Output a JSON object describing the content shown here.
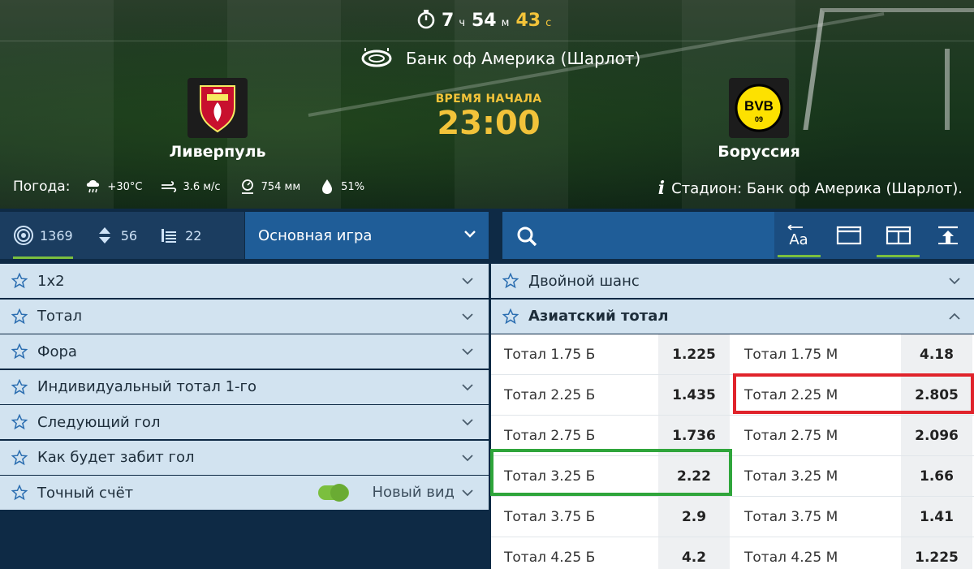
{
  "countdown": {
    "hours": "7",
    "hours_unit": "ч",
    "minutes": "54",
    "minutes_unit": "м",
    "seconds": "43",
    "seconds_unit": "с"
  },
  "venue": "Банк оф Америка (Шарлот)",
  "home_team": "Ливерпуль",
  "away_team": "Боруссия",
  "kickoff": {
    "label": "ВРЕМЯ НАЧАЛА",
    "time": "23:00"
  },
  "weather": {
    "label": "Погода:",
    "temperature": "+30°C",
    "wind": "3.6 м/с",
    "pressure": "754 мм",
    "humidity": "51%"
  },
  "stadium_label": "Стадион: Банк оф Америка (Шарлот).",
  "toolbar": {
    "stats": [
      {
        "icon": "target-icon",
        "value": "1369"
      },
      {
        "icon": "updown-icon",
        "value": "56"
      },
      {
        "icon": "stats-list-icon",
        "value": "22"
      }
    ],
    "game_select": "Основная игра",
    "font_tool": "Aa"
  },
  "left_markets": [
    "1x2",
    "Тотал",
    "Фора",
    "Индивидуальный тотал 1-го",
    "Следующий гол",
    "Как будет забит гол",
    "Точный счёт"
  ],
  "new_view_label": "Новый вид",
  "right_markets": {
    "double_chance": "Двойной шанс",
    "asian_total": "Азиатский тотал"
  },
  "asian_total_rows": [
    {
      "over_label": "Тотал 1.75 Б",
      "over_odds": "1.225",
      "under_label": "Тотал 1.75 М",
      "under_odds": "4.18"
    },
    {
      "over_label": "Тотал 2.25 Б",
      "over_odds": "1.435",
      "under_label": "Тотал 2.25 М",
      "under_odds": "2.805"
    },
    {
      "over_label": "Тотал 2.75 Б",
      "over_odds": "1.736",
      "under_label": "Тотал 2.75 М",
      "under_odds": "2.096"
    },
    {
      "over_label": "Тотал 3.25 Б",
      "over_odds": "2.22",
      "under_label": "Тотал 3.25 М",
      "under_odds": "1.66"
    },
    {
      "over_label": "Тотал 3.75 Б",
      "over_odds": "2.9",
      "under_label": "Тотал 3.75 М",
      "under_odds": "1.41"
    },
    {
      "over_label": "Тотал 4.25 Б",
      "over_odds": "4.2",
      "under_label": "Тотал 4.25 М",
      "under_odds": "1.225"
    }
  ],
  "colors": {
    "accent_gold": "#f2c33a",
    "toolbar_blue": "#1f5d98",
    "market_row": "#d2e3f0",
    "highlight_red": "#e0232b",
    "highlight_green": "#2fa53b",
    "active_green": "#7bbf3e"
  }
}
